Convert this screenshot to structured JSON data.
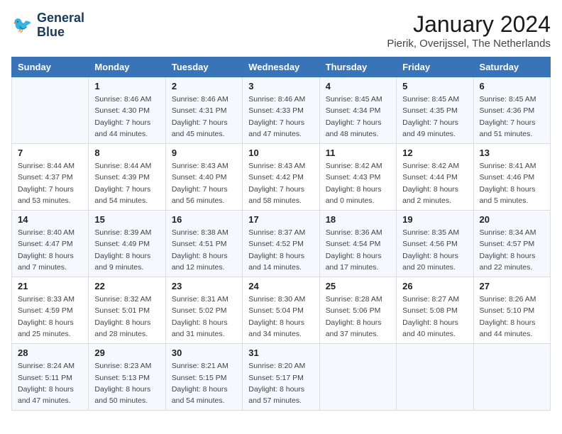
{
  "header": {
    "logo_line1": "General",
    "logo_line2": "Blue",
    "month": "January 2024",
    "location": "Pierik, Overijssel, The Netherlands"
  },
  "days_of_week": [
    "Sunday",
    "Monday",
    "Tuesday",
    "Wednesday",
    "Thursday",
    "Friday",
    "Saturday"
  ],
  "weeks": [
    [
      {
        "num": "",
        "detail": ""
      },
      {
        "num": "1",
        "detail": "Sunrise: 8:46 AM\nSunset: 4:30 PM\nDaylight: 7 hours\nand 44 minutes."
      },
      {
        "num": "2",
        "detail": "Sunrise: 8:46 AM\nSunset: 4:31 PM\nDaylight: 7 hours\nand 45 minutes."
      },
      {
        "num": "3",
        "detail": "Sunrise: 8:46 AM\nSunset: 4:33 PM\nDaylight: 7 hours\nand 47 minutes."
      },
      {
        "num": "4",
        "detail": "Sunrise: 8:45 AM\nSunset: 4:34 PM\nDaylight: 7 hours\nand 48 minutes."
      },
      {
        "num": "5",
        "detail": "Sunrise: 8:45 AM\nSunset: 4:35 PM\nDaylight: 7 hours\nand 49 minutes."
      },
      {
        "num": "6",
        "detail": "Sunrise: 8:45 AM\nSunset: 4:36 PM\nDaylight: 7 hours\nand 51 minutes."
      }
    ],
    [
      {
        "num": "7",
        "detail": "Sunrise: 8:44 AM\nSunset: 4:37 PM\nDaylight: 7 hours\nand 53 minutes."
      },
      {
        "num": "8",
        "detail": "Sunrise: 8:44 AM\nSunset: 4:39 PM\nDaylight: 7 hours\nand 54 minutes."
      },
      {
        "num": "9",
        "detail": "Sunrise: 8:43 AM\nSunset: 4:40 PM\nDaylight: 7 hours\nand 56 minutes."
      },
      {
        "num": "10",
        "detail": "Sunrise: 8:43 AM\nSunset: 4:42 PM\nDaylight: 7 hours\nand 58 minutes."
      },
      {
        "num": "11",
        "detail": "Sunrise: 8:42 AM\nSunset: 4:43 PM\nDaylight: 8 hours\nand 0 minutes."
      },
      {
        "num": "12",
        "detail": "Sunrise: 8:42 AM\nSunset: 4:44 PM\nDaylight: 8 hours\nand 2 minutes."
      },
      {
        "num": "13",
        "detail": "Sunrise: 8:41 AM\nSunset: 4:46 PM\nDaylight: 8 hours\nand 5 minutes."
      }
    ],
    [
      {
        "num": "14",
        "detail": "Sunrise: 8:40 AM\nSunset: 4:47 PM\nDaylight: 8 hours\nand 7 minutes."
      },
      {
        "num": "15",
        "detail": "Sunrise: 8:39 AM\nSunset: 4:49 PM\nDaylight: 8 hours\nand 9 minutes."
      },
      {
        "num": "16",
        "detail": "Sunrise: 8:38 AM\nSunset: 4:51 PM\nDaylight: 8 hours\nand 12 minutes."
      },
      {
        "num": "17",
        "detail": "Sunrise: 8:37 AM\nSunset: 4:52 PM\nDaylight: 8 hours\nand 14 minutes."
      },
      {
        "num": "18",
        "detail": "Sunrise: 8:36 AM\nSunset: 4:54 PM\nDaylight: 8 hours\nand 17 minutes."
      },
      {
        "num": "19",
        "detail": "Sunrise: 8:35 AM\nSunset: 4:56 PM\nDaylight: 8 hours\nand 20 minutes."
      },
      {
        "num": "20",
        "detail": "Sunrise: 8:34 AM\nSunset: 4:57 PM\nDaylight: 8 hours\nand 22 minutes."
      }
    ],
    [
      {
        "num": "21",
        "detail": "Sunrise: 8:33 AM\nSunset: 4:59 PM\nDaylight: 8 hours\nand 25 minutes."
      },
      {
        "num": "22",
        "detail": "Sunrise: 8:32 AM\nSunset: 5:01 PM\nDaylight: 8 hours\nand 28 minutes."
      },
      {
        "num": "23",
        "detail": "Sunrise: 8:31 AM\nSunset: 5:02 PM\nDaylight: 8 hours\nand 31 minutes."
      },
      {
        "num": "24",
        "detail": "Sunrise: 8:30 AM\nSunset: 5:04 PM\nDaylight: 8 hours\nand 34 minutes."
      },
      {
        "num": "25",
        "detail": "Sunrise: 8:28 AM\nSunset: 5:06 PM\nDaylight: 8 hours\nand 37 minutes."
      },
      {
        "num": "26",
        "detail": "Sunrise: 8:27 AM\nSunset: 5:08 PM\nDaylight: 8 hours\nand 40 minutes."
      },
      {
        "num": "27",
        "detail": "Sunrise: 8:26 AM\nSunset: 5:10 PM\nDaylight: 8 hours\nand 44 minutes."
      }
    ],
    [
      {
        "num": "28",
        "detail": "Sunrise: 8:24 AM\nSunset: 5:11 PM\nDaylight: 8 hours\nand 47 minutes."
      },
      {
        "num": "29",
        "detail": "Sunrise: 8:23 AM\nSunset: 5:13 PM\nDaylight: 8 hours\nand 50 minutes."
      },
      {
        "num": "30",
        "detail": "Sunrise: 8:21 AM\nSunset: 5:15 PM\nDaylight: 8 hours\nand 54 minutes."
      },
      {
        "num": "31",
        "detail": "Sunrise: 8:20 AM\nSunset: 5:17 PM\nDaylight: 8 hours\nand 57 minutes."
      },
      {
        "num": "",
        "detail": ""
      },
      {
        "num": "",
        "detail": ""
      },
      {
        "num": "",
        "detail": ""
      }
    ]
  ]
}
